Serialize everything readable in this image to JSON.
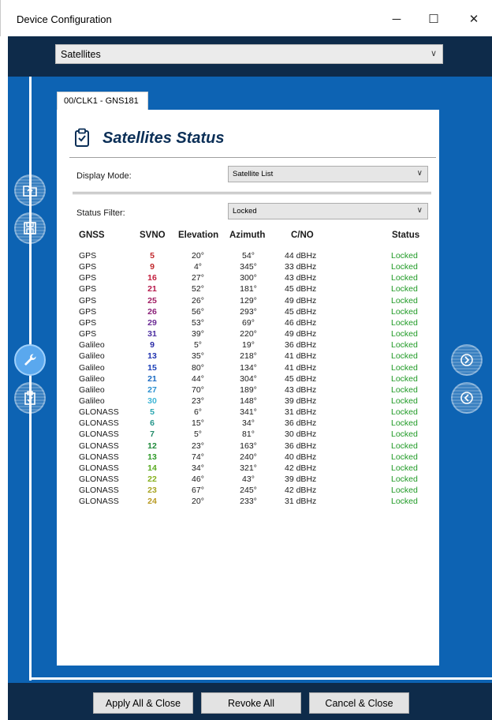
{
  "window": {
    "title": "Device Configuration",
    "min_glyph": "─",
    "max_glyph": "☐",
    "close_glyph": "✕"
  },
  "top_select": {
    "value": "Satellites"
  },
  "tab": {
    "label": "00/CLK1 - GNS181"
  },
  "panel": {
    "title": "Satellites Status",
    "display_mode_label": "Display Mode:",
    "display_mode_value": "Satellite List",
    "status_filter_label": "Status Filter:",
    "status_filter_value": "Locked"
  },
  "table": {
    "headers": [
      "GNSS",
      "SVNO",
      "Elevation",
      "Azimuth",
      "C/NO",
      "Status"
    ],
    "rows": [
      {
        "gnss": "GPS",
        "svno": "5",
        "elev": "20°",
        "az": "54°",
        "cno": "44 dBHz",
        "status": "Locked",
        "color": "#c0262a"
      },
      {
        "gnss": "GPS",
        "svno": "9",
        "elev": "4°",
        "az": "345°",
        "cno": "33 dBHz",
        "status": "Locked",
        "color": "#c0262a"
      },
      {
        "gnss": "GPS",
        "svno": "16",
        "elev": "27°",
        "az": "300°",
        "cno": "43 dBHz",
        "status": "Locked",
        "color": "#c4203f"
      },
      {
        "gnss": "GPS",
        "svno": "21",
        "elev": "52°",
        "az": "181°",
        "cno": "45 dBHz",
        "status": "Locked",
        "color": "#b5184a"
      },
      {
        "gnss": "GPS",
        "svno": "25",
        "elev": "26°",
        "az": "129°",
        "cno": "49 dBHz",
        "status": "Locked",
        "color": "#a01c62"
      },
      {
        "gnss": "GPS",
        "svno": "26",
        "elev": "56°",
        "az": "293°",
        "cno": "45 dBHz",
        "status": "Locked",
        "color": "#8a1f78"
      },
      {
        "gnss": "GPS",
        "svno": "29",
        "elev": "53°",
        "az": "69°",
        "cno": "46 dBHz",
        "status": "Locked",
        "color": "#6a2a94"
      },
      {
        "gnss": "GPS",
        "svno": "31",
        "elev": "39°",
        "az": "220°",
        "cno": "49 dBHz",
        "status": "Locked",
        "color": "#4b2ea0"
      },
      {
        "gnss": "Galileo",
        "svno": "9",
        "elev": "5°",
        "az": "19°",
        "cno": "36 dBHz",
        "status": "Locked",
        "color": "#2a2aa6"
      },
      {
        "gnss": "Galileo",
        "svno": "13",
        "elev": "35°",
        "az": "218°",
        "cno": "41 dBHz",
        "status": "Locked",
        "color": "#2234b0"
      },
      {
        "gnss": "Galileo",
        "svno": "15",
        "elev": "80°",
        "az": "134°",
        "cno": "41 dBHz",
        "status": "Locked",
        "color": "#1c40b8"
      },
      {
        "gnss": "Galileo",
        "svno": "21",
        "elev": "44°",
        "az": "304°",
        "cno": "45 dBHz",
        "status": "Locked",
        "color": "#1b6ac2"
      },
      {
        "gnss": "Galileo",
        "svno": "27",
        "elev": "70°",
        "az": "189°",
        "cno": "43 dBHz",
        "status": "Locked",
        "color": "#2a8fd0"
      },
      {
        "gnss": "Galileo",
        "svno": "30",
        "elev": "23°",
        "az": "148°",
        "cno": "39 dBHz",
        "status": "Locked",
        "color": "#3fb6d6"
      },
      {
        "gnss": "GLONASS",
        "svno": "5",
        "elev": "6°",
        "az": "341°",
        "cno": "31 dBHz",
        "status": "Locked",
        "color": "#2aa6b0"
      },
      {
        "gnss": "GLONASS",
        "svno": "6",
        "elev": "15°",
        "az": "34°",
        "cno": "36 dBHz",
        "status": "Locked",
        "color": "#23958a"
      },
      {
        "gnss": "GLONASS",
        "svno": "7",
        "elev": "5°",
        "az": "81°",
        "cno": "30 dBHz",
        "status": "Locked",
        "color": "#238a68"
      },
      {
        "gnss": "GLONASS",
        "svno": "12",
        "elev": "23°",
        "az": "163°",
        "cno": "36 dBHz",
        "status": "Locked",
        "color": "#1f8a3a"
      },
      {
        "gnss": "GLONASS",
        "svno": "13",
        "elev": "74°",
        "az": "240°",
        "cno": "40 dBHz",
        "status": "Locked",
        "color": "#2f9a2a"
      },
      {
        "gnss": "GLONASS",
        "svno": "14",
        "elev": "34°",
        "az": "321°",
        "cno": "42 dBHz",
        "status": "Locked",
        "color": "#5aab22"
      },
      {
        "gnss": "GLONASS",
        "svno": "22",
        "elev": "46°",
        "az": "43°",
        "cno": "39 dBHz",
        "status": "Locked",
        "color": "#86b01e"
      },
      {
        "gnss": "GLONASS",
        "svno": "23",
        "elev": "67°",
        "az": "245°",
        "cno": "42 dBHz",
        "status": "Locked",
        "color": "#a8a422"
      },
      {
        "gnss": "GLONASS",
        "svno": "24",
        "elev": "20°",
        "az": "233°",
        "cno": "31 dBHz",
        "status": "Locked",
        "color": "#b89a22"
      }
    ]
  },
  "footer": {
    "apply_label": "Apply All & Close",
    "revoke_label": "Revoke All",
    "cancel_label": "Cancel & Close"
  },
  "icons": {
    "sidebar": [
      "folder-upload-icon",
      "save-icon",
      "wrench-icon",
      "clipboard-icon"
    ],
    "nav": [
      "arrow-right-icon",
      "arrow-left-icon"
    ],
    "title": "clipboard-check-icon"
  },
  "colors": {
    "dark_band": "#0e2b4a",
    "body_blue": "#0d63b3",
    "title_navy": "#0b2f57",
    "status_green": "#1f9a25"
  }
}
